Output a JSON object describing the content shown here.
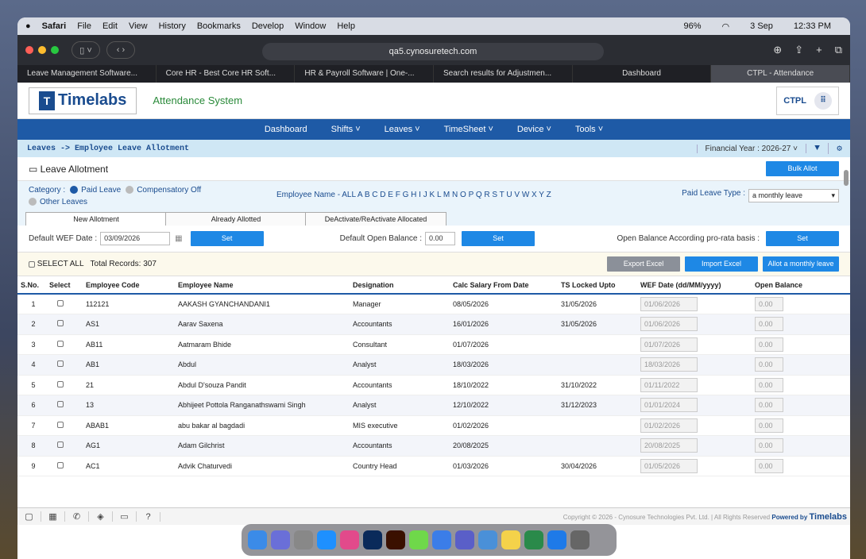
{
  "menubar": {
    "app": "Safari",
    "items": [
      "File",
      "Edit",
      "View",
      "History",
      "Bookmarks",
      "Develop",
      "Window",
      "Help"
    ],
    "battery": "96%",
    "date": "3 Sep",
    "time": "12:33 PM"
  },
  "browser": {
    "url": "qa5.cynosuretech.com",
    "tabs": [
      "Leave Management Software...",
      "Core HR - Best Core HR Soft...",
      "HR & Payroll Software | One-...",
      "Search results for Adjustmen...",
      "Dashboard",
      "CTPL - Attendance"
    ]
  },
  "app": {
    "logo": "Timelabs",
    "title": "Attendance System",
    "company": "CTPL"
  },
  "nav": [
    "Dashboard",
    "Shifts ˅",
    "Leaves ˅",
    "TimeSheet ˅",
    "Device ˅",
    "Tools ˅"
  ],
  "breadcrumb": "Leaves -> Employee Leave Allotment",
  "financial_year": {
    "label": "Financial Year :",
    "value": "2026-27"
  },
  "section": {
    "title": "Leave Allotment",
    "bulk_button": "Bulk Allot"
  },
  "category": {
    "label": "Category :",
    "options": [
      "Paid Leave",
      "Compensatory Off",
      "Other Leaves"
    ],
    "selected": "Paid Leave"
  },
  "employee_name": {
    "label": "Employee Name - ALL",
    "letters": "A B C D E F G H I J K L M N O P Q R S T U V W X Y Z"
  },
  "paid_leave_type": {
    "label": "Paid Leave Type :",
    "value": "a monthly leave"
  },
  "tabs": [
    "New Allotment",
    "Already Allotted",
    "DeActivate/ReActivate Allocated"
  ],
  "defaults": {
    "wef_label": "Default WEF Date :",
    "wef_value": "03/09/2026",
    "set": "Set",
    "open_label": "Default Open Balance :",
    "open_value": "0.00",
    "prorata_label": "Open Balance According pro-rata basis :"
  },
  "actions": {
    "select_all": "SELECT ALL",
    "total": "Total Records: 307",
    "export": "Export Excel",
    "import": "Import Excel",
    "allot": "Allot a monthly leave"
  },
  "columns": [
    "S.No.",
    "Select",
    "Employee Code",
    "Employee Name",
    "Designation",
    "Calc Salary From Date",
    "TS Locked Upto",
    "WEF Date (dd/MM/yyyy)",
    "Open Balance"
  ],
  "rows": [
    [
      "1",
      "112121",
      "AAKASH GYANCHANDANI1",
      "Manager",
      "08/05/2026",
      "31/05/2026",
      "01/06/2026",
      "0.00"
    ],
    [
      "2",
      "AS1",
      "Aarav Saxena",
      "Accountants",
      "16/01/2026",
      "31/05/2026",
      "01/06/2026",
      "0.00"
    ],
    [
      "3",
      "AB11",
      "Aatmaram Bhide",
      "Consultant",
      "01/07/2026",
      "",
      "01/07/2026",
      "0.00"
    ],
    [
      "4",
      "AB1",
      "Abdul",
      "Analyst",
      "18/03/2026",
      "",
      "18/03/2026",
      "0.00"
    ],
    [
      "5",
      "21",
      "Abdul D'souza Pandit",
      "Accountants",
      "18/10/2022",
      "31/10/2022",
      "01/11/2022",
      "0.00"
    ],
    [
      "6",
      "13",
      "Abhijeet Pottola Ranganathswami Singh",
      "Analyst",
      "12/10/2022",
      "31/12/2023",
      "01/01/2024",
      "0.00"
    ],
    [
      "7",
      "ABAB1",
      "abu bakar al bagdadi",
      "MIS executive",
      "01/02/2026",
      "",
      "01/02/2026",
      "0.00"
    ],
    [
      "8",
      "AG1",
      "Adam Gilchrist",
      "Accountants",
      "20/08/2025",
      "",
      "20/08/2025",
      "0.00"
    ],
    [
      "9",
      "AC1",
      "Advik Chaturvedi",
      "Country Head",
      "01/03/2026",
      "30/04/2026",
      "01/05/2026",
      "0.00"
    ]
  ],
  "footer": {
    "copyright": "Copyright © 2026 - Cynosure Technologies Pvt. Ltd. | All Rights Reserved",
    "powered": "Powered by",
    "brand": "Timelabs"
  }
}
